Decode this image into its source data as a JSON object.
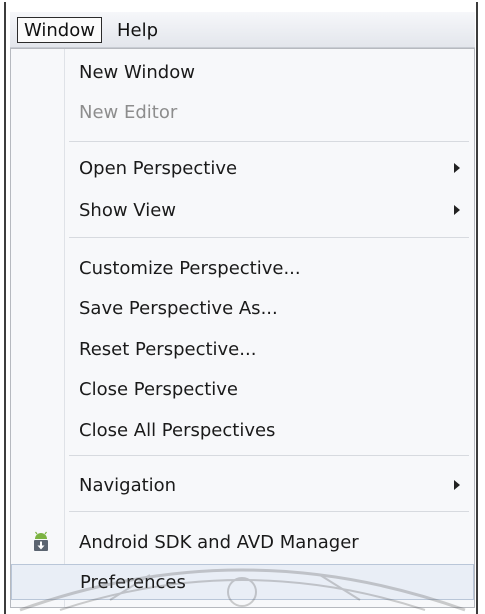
{
  "menubar": {
    "items": [
      {
        "label": "Window"
      },
      {
        "label": "Help"
      }
    ]
  },
  "menu": {
    "items": [
      {
        "label": "New Window"
      },
      {
        "label": "New Editor"
      },
      {
        "label": "Open Perspective"
      },
      {
        "label": "Show View"
      },
      {
        "label": "Customize Perspective..."
      },
      {
        "label": "Save Perspective As..."
      },
      {
        "label": "Reset Perspective..."
      },
      {
        "label": "Close Perspective"
      },
      {
        "label": "Close All Perspectives"
      },
      {
        "label": "Navigation"
      },
      {
        "label": "Android SDK and AVD Manager",
        "icon": "android-sdk-icon"
      },
      {
        "label": "Preferences"
      }
    ]
  },
  "colors": {
    "menu_background": "#f7f8fa",
    "disabled_text": "#8d8d8d",
    "android_green": "#7cb342"
  }
}
